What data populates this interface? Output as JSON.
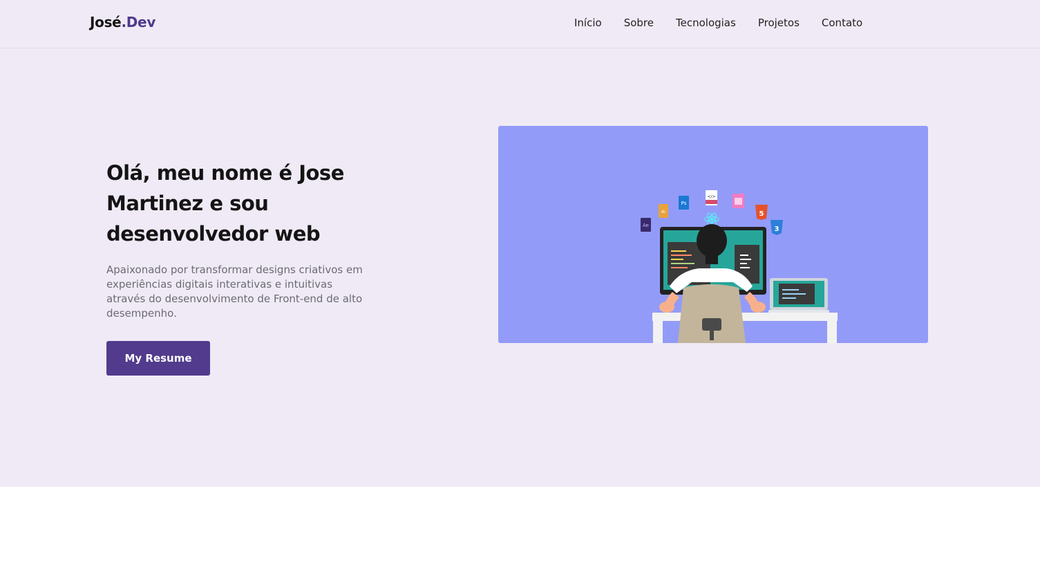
{
  "brand": {
    "name": "José",
    "accent": ".Dev"
  },
  "nav": {
    "items": [
      "Início",
      "Sobre",
      "Tecnologias",
      "Projetos",
      "Contato"
    ]
  },
  "hero": {
    "title": "Olá, meu nome é Jose Martinez e sou desenvolvedor web",
    "description": "Apaixonado por transformar designs criativos em experiências digitais interativas e intuitivas através do desenvolvimento de Front-end de alto desempenho.",
    "button_label": "My Resume",
    "illustration_badges": {
      "ps": "Ps",
      "ae": "Ae",
      "ai": "Ai"
    }
  },
  "colors": {
    "accent": "#523b8d",
    "background": "#f0eaf6",
    "illustration_bg": "#939bf8"
  }
}
